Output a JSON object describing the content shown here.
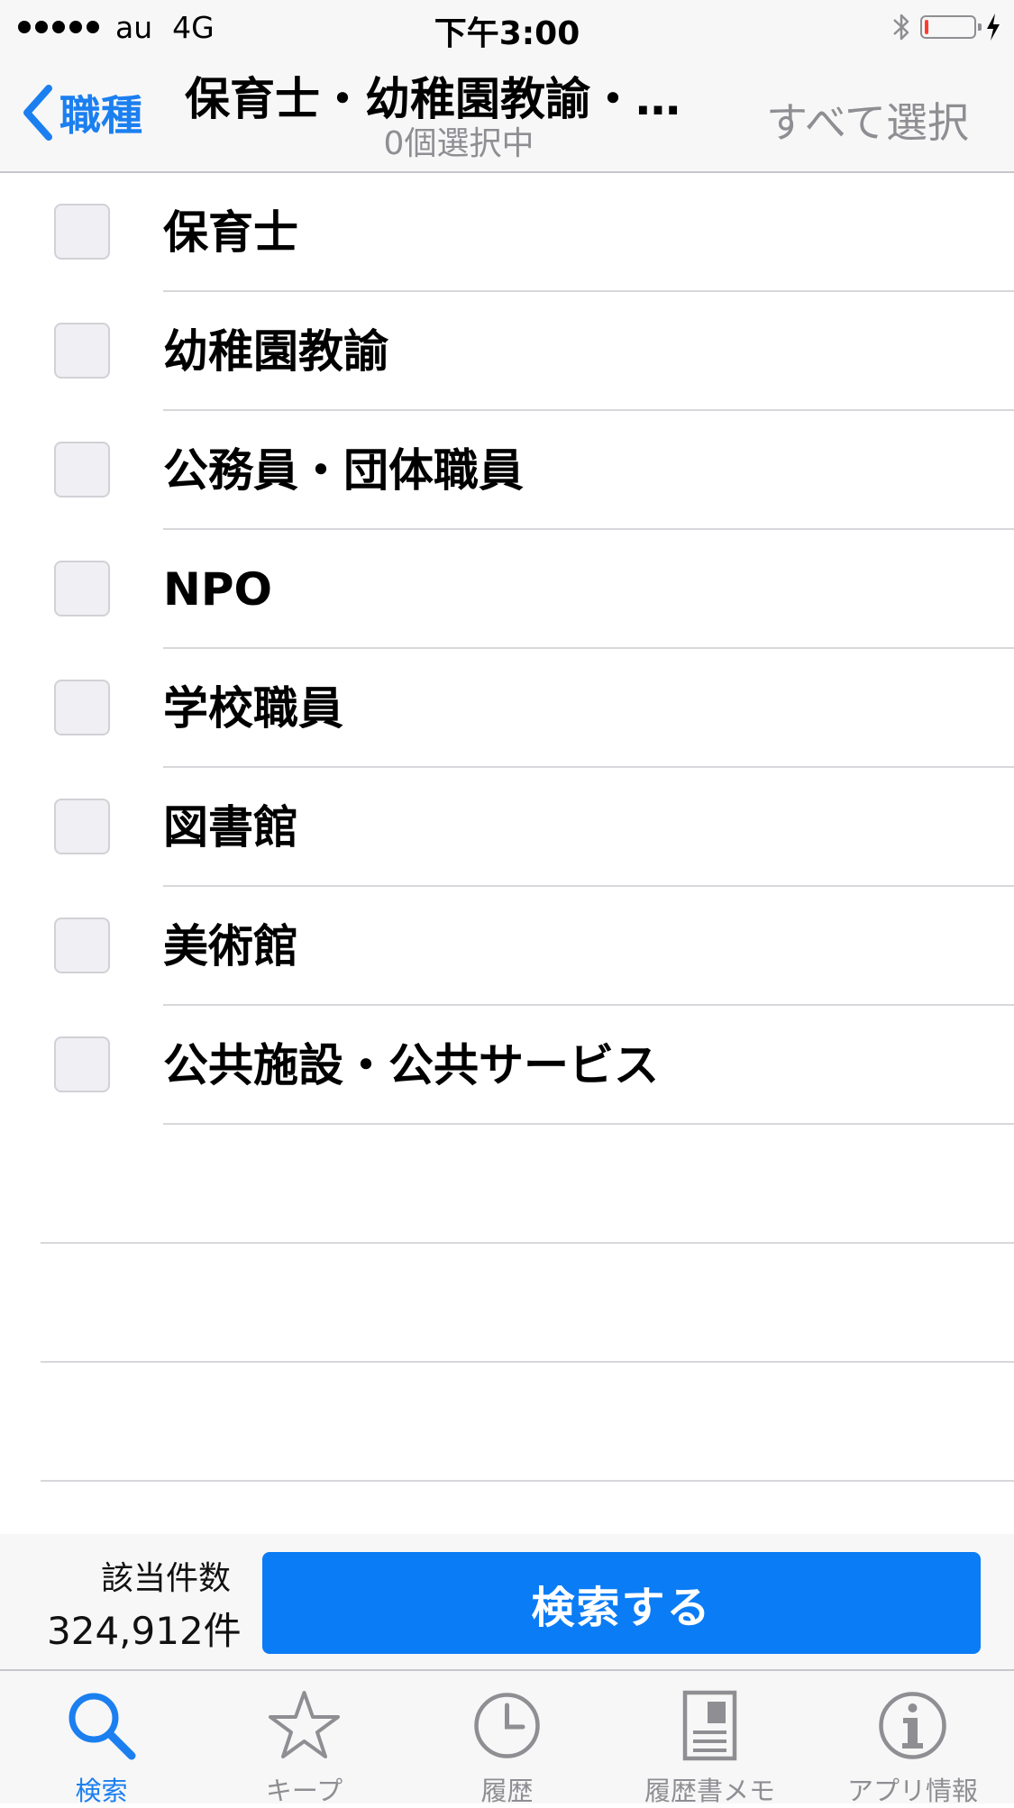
{
  "status_bar": {
    "carrier": "au",
    "network": "4G",
    "time": "下午3:00",
    "battery_level": 0.08
  },
  "nav": {
    "back_label": "職種",
    "title": "保育士・幼稚園教諭・…",
    "subtitle": "0個選択中",
    "select_all_label": "すべて選択"
  },
  "items": [
    {
      "label": "保育士",
      "checked": false
    },
    {
      "label": "幼稚園教諭",
      "checked": false
    },
    {
      "label": "公務員・団体職員",
      "checked": false
    },
    {
      "label": "NPO",
      "checked": false
    },
    {
      "label": "学校職員",
      "checked": false
    },
    {
      "label": "図書館",
      "checked": false
    },
    {
      "label": "美術館",
      "checked": false
    },
    {
      "label": "公共施設・公共サービス",
      "checked": false
    }
  ],
  "search_bar": {
    "count_label": "該当件数",
    "count_value": "324,912件",
    "search_button_label": "検索する"
  },
  "tabs": [
    {
      "label": "検索",
      "icon": "search-icon",
      "active": true
    },
    {
      "label": "キープ",
      "icon": "star-icon",
      "active": false
    },
    {
      "label": "履歴",
      "icon": "clock-icon",
      "active": false
    },
    {
      "label": "履歴書メモ",
      "icon": "document-icon",
      "active": false
    },
    {
      "label": "アプリ情報",
      "icon": "info-icon",
      "active": false
    }
  ],
  "colors": {
    "accent": "#1b7ff0",
    "button": "#0a7cf5",
    "inactive": "#8e8e93"
  }
}
